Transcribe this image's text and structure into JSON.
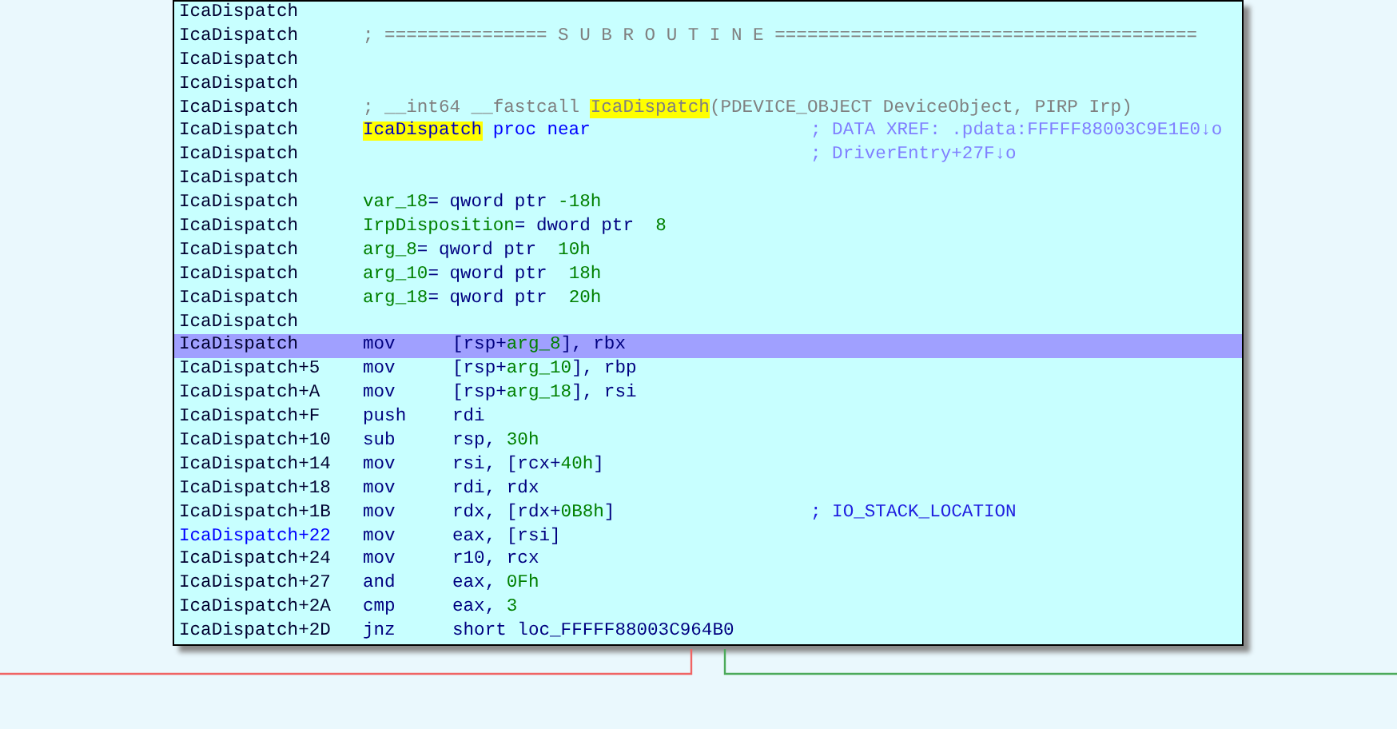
{
  "lines": [
    {
      "address": "IcaDispatch",
      "selected": false,
      "target": false
    },
    {
      "address": "IcaDispatch",
      "selected": false,
      "target": false,
      "code": [
        {
          "text": "; =============== S U B R O U T I N E =======================================",
          "kind": "comment"
        }
      ]
    },
    {
      "address": "IcaDispatch",
      "selected": false,
      "target": false
    },
    {
      "address": "IcaDispatch",
      "selected": false,
      "target": false
    },
    {
      "address": "IcaDispatch",
      "selected": false,
      "target": false,
      "code": [
        {
          "text": "; __int64 __fastcall ",
          "kind": "comment"
        },
        {
          "text": "IcaDispatch",
          "kind": "highlight"
        },
        {
          "text": "(PDEVICE_OBJECT DeviceObject, PIRP Irp)",
          "kind": "comment"
        }
      ]
    },
    {
      "address": "IcaDispatch",
      "selected": false,
      "target": false,
      "code": [
        {
          "text": "IcaDispatch",
          "kind": "label"
        },
        {
          "text": " proc near",
          "kind": "keyword"
        }
      ],
      "comment": [
        {
          "text": "; DATA XREF: .pdata:FFFFF88003C9E1E0↓o",
          "kind": "xref"
        }
      ]
    },
    {
      "address": "IcaDispatch",
      "selected": false,
      "target": false,
      "comment": [
        {
          "text": "; DriverEntry+27F↓o",
          "kind": "xref"
        }
      ]
    },
    {
      "address": "IcaDispatch",
      "selected": false,
      "target": false
    },
    {
      "address": "IcaDispatch",
      "selected": false,
      "target": false,
      "code": [
        {
          "text": "var_18",
          "kind": "var"
        },
        {
          "text": "= qword ptr ",
          "kind": "plain"
        },
        {
          "text": "-18h",
          "kind": "number"
        }
      ]
    },
    {
      "address": "IcaDispatch",
      "selected": false,
      "target": false,
      "code": [
        {
          "text": "IrpDisposition",
          "kind": "var"
        },
        {
          "text": "= dword ptr  ",
          "kind": "plain"
        },
        {
          "text": "8",
          "kind": "number"
        }
      ]
    },
    {
      "address": "IcaDispatch",
      "selected": false,
      "target": false,
      "code": [
        {
          "text": "arg_8",
          "kind": "var"
        },
        {
          "text": "= qword ptr  ",
          "kind": "plain"
        },
        {
          "text": "10h",
          "kind": "number"
        }
      ]
    },
    {
      "address": "IcaDispatch",
      "selected": false,
      "target": false,
      "code": [
        {
          "text": "arg_10",
          "kind": "var"
        },
        {
          "text": "= qword ptr  ",
          "kind": "plain"
        },
        {
          "text": "18h",
          "kind": "number"
        }
      ]
    },
    {
      "address": "IcaDispatch",
      "selected": false,
      "target": false,
      "code": [
        {
          "text": "arg_18",
          "kind": "var"
        },
        {
          "text": "= qword ptr  ",
          "kind": "plain"
        },
        {
          "text": "20h",
          "kind": "number"
        }
      ]
    },
    {
      "address": "IcaDispatch",
      "selected": false,
      "target": false
    },
    {
      "address": "IcaDispatch",
      "selected": true,
      "target": false,
      "mnemonic": "mov",
      "operands": [
        {
          "text": "[rsp+",
          "kind": "plain"
        },
        {
          "text": "arg_8",
          "kind": "var"
        },
        {
          "text": "], rbx",
          "kind": "plain"
        }
      ]
    },
    {
      "address": "IcaDispatch+5",
      "selected": false,
      "target": false,
      "mnemonic": "mov",
      "operands": [
        {
          "text": "[rsp+",
          "kind": "plain"
        },
        {
          "text": "arg_10",
          "kind": "var"
        },
        {
          "text": "], rbp",
          "kind": "plain"
        }
      ]
    },
    {
      "address": "IcaDispatch+A",
      "selected": false,
      "target": false,
      "mnemonic": "mov",
      "operands": [
        {
          "text": "[rsp+",
          "kind": "plain"
        },
        {
          "text": "arg_18",
          "kind": "var"
        },
        {
          "text": "], rsi",
          "kind": "plain"
        }
      ]
    },
    {
      "address": "IcaDispatch+F",
      "selected": false,
      "target": false,
      "mnemonic": "push",
      "operands": [
        {
          "text": "rdi",
          "kind": "plain"
        }
      ]
    },
    {
      "address": "IcaDispatch+10",
      "selected": false,
      "target": false,
      "mnemonic": "sub",
      "operands": [
        {
          "text": "rsp, ",
          "kind": "plain"
        },
        {
          "text": "30h",
          "kind": "number"
        }
      ]
    },
    {
      "address": "IcaDispatch+14",
      "selected": false,
      "target": false,
      "mnemonic": "mov",
      "operands": [
        {
          "text": "rsi, [rcx+",
          "kind": "plain"
        },
        {
          "text": "40h",
          "kind": "number"
        },
        {
          "text": "]",
          "kind": "plain"
        }
      ]
    },
    {
      "address": "IcaDispatch+18",
      "selected": false,
      "target": false,
      "mnemonic": "mov",
      "operands": [
        {
          "text": "rdi, rdx",
          "kind": "plain"
        }
      ]
    },
    {
      "address": "IcaDispatch+1B",
      "selected": false,
      "target": false,
      "mnemonic": "mov",
      "operands": [
        {
          "text": "rdx, [rdx+",
          "kind": "plain"
        },
        {
          "text": "0B8h",
          "kind": "number"
        },
        {
          "text": "]",
          "kind": "plain"
        }
      ],
      "comment": [
        {
          "text": "; IO_STACK_LOCATION",
          "kind": "type"
        }
      ]
    },
    {
      "address": "IcaDispatch+22",
      "selected": false,
      "target": true,
      "mnemonic": "mov",
      "operands": [
        {
          "text": "eax, [rsi]",
          "kind": "plain"
        }
      ]
    },
    {
      "address": "IcaDispatch+24",
      "selected": false,
      "target": false,
      "mnemonic": "mov",
      "operands": [
        {
          "text": "r10, rcx",
          "kind": "plain"
        }
      ]
    },
    {
      "address": "IcaDispatch+27",
      "selected": false,
      "target": false,
      "mnemonic": "and",
      "operands": [
        {
          "text": "eax, ",
          "kind": "plain"
        },
        {
          "text": "0Fh",
          "kind": "number"
        }
      ]
    },
    {
      "address": "IcaDispatch+2A",
      "selected": false,
      "target": false,
      "mnemonic": "cmp",
      "operands": [
        {
          "text": "eax, ",
          "kind": "plain"
        },
        {
          "text": "3",
          "kind": "number"
        }
      ]
    },
    {
      "address": "IcaDispatch+2D",
      "selected": false,
      "target": false,
      "mnemonic": "jnz",
      "operands": [
        {
          "text": "short loc_FFFFF88003C964B0",
          "kind": "plain"
        }
      ]
    }
  ]
}
